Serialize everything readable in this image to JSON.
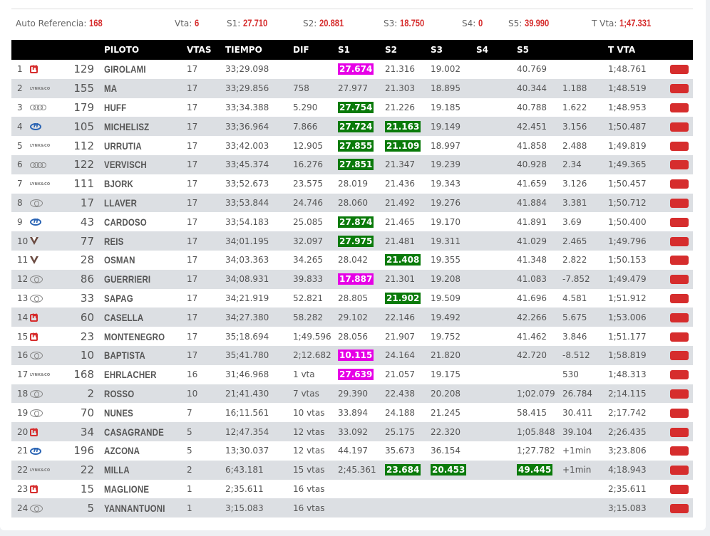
{
  "header": {
    "auto_ref_label": "Auto Referencia:",
    "auto_ref_value": "168",
    "vta_label": "Vta:",
    "vta_value": "6",
    "s1_label": "S1:",
    "s1_value": "27.710",
    "s2_label": "S2:",
    "s2_value": "20.881",
    "s3_label": "S3:",
    "s3_value": "18.750",
    "s4_label": "S4:",
    "s4_value": "0",
    "s5_label": "S5:",
    "s5_value": "39.990",
    "tvta_label": "T Vta:",
    "tvta_value": "1;47.331"
  },
  "columns": {
    "piloto": "PILOTO",
    "vtas": "VTAS",
    "tiempo": "TIEMPO",
    "dif": "DIF",
    "s1": "S1",
    "s2": "S2",
    "s3": "S3",
    "s4": "S4",
    "s5": "S5",
    "tvta": "T VTA"
  },
  "colors": {
    "accent_red": "#d62d2d",
    "best_pink": "#e600e6",
    "best_green": "#0a7a0a"
  },
  "rows": [
    {
      "pos": "1",
      "brand": "honda",
      "num": "129",
      "name": "GIROLAMI",
      "vtas": "17",
      "tiempo": "33;29.098",
      "dif": "",
      "s1": "27.674",
      "s1h": "pink",
      "s2": "21.316",
      "s2h": "",
      "s3": "19.002",
      "s3h": "",
      "s5": "40.769",
      "s5h": "",
      "gap": "",
      "tvta": "1;48.761"
    },
    {
      "pos": "2",
      "brand": "lynk",
      "num": "155",
      "name": "MA",
      "vtas": "17",
      "tiempo": "33;29.856",
      "dif": "758",
      "s1": "27.977",
      "s1h": "",
      "s2": "21.303",
      "s2h": "",
      "s3": "18.895",
      "s3h": "",
      "s5": "40.344",
      "s5h": "",
      "gap": "1.188",
      "tvta": "1;48.519"
    },
    {
      "pos": "3",
      "brand": "audi",
      "num": "179",
      "name": "HUFF",
      "vtas": "17",
      "tiempo": "33;34.388",
      "dif": "5.290",
      "s1": "27.754",
      "s1h": "green",
      "s2": "21.226",
      "s2h": "",
      "s3": "19.185",
      "s3h": "",
      "s5": "40.788",
      "s5h": "",
      "gap": "1.622",
      "tvta": "1;48.953"
    },
    {
      "pos": "4",
      "brand": "hyundai",
      "num": "105",
      "name": "MICHELISZ",
      "vtas": "17",
      "tiempo": "33;36.964",
      "dif": "7.866",
      "s1": "27.724",
      "s1h": "green",
      "s2": "21.163",
      "s2h": "green",
      "s3": "19.149",
      "s3h": "",
      "s5": "42.451",
      "s5h": "",
      "gap": "3.156",
      "tvta": "1;50.487"
    },
    {
      "pos": "5",
      "brand": "lynk",
      "num": "112",
      "name": "URRUTIA",
      "vtas": "17",
      "tiempo": "33;42.003",
      "dif": "12.905",
      "s1": "27.855",
      "s1h": "green",
      "s2": "21.109",
      "s2h": "green",
      "s3": "18.997",
      "s3h": "",
      "s5": "41.858",
      "s5h": "",
      "gap": "2.488",
      "tvta": "1;49.819"
    },
    {
      "pos": "6",
      "brand": "audi",
      "num": "122",
      "name": "VERVISCH",
      "vtas": "17",
      "tiempo": "33;45.374",
      "dif": "16.276",
      "s1": "27.851",
      "s1h": "green",
      "s2": "21.347",
      "s2h": "",
      "s3": "19.239",
      "s3h": "",
      "s5": "40.928",
      "s5h": "",
      "gap": "2.34",
      "tvta": "1;49.365"
    },
    {
      "pos": "7",
      "brand": "lynk",
      "num": "111",
      "name": "BJORK",
      "vtas": "17",
      "tiempo": "33;52.673",
      "dif": "23.575",
      "s1": "28.019",
      "s1h": "",
      "s2": "21.436",
      "s2h": "",
      "s3": "19.343",
      "s3h": "",
      "s5": "41.659",
      "s5h": "",
      "gap": "3.126",
      "tvta": "1;50.457"
    },
    {
      "pos": "8",
      "brand": "toyota",
      "num": "17",
      "name": "LLAVER",
      "vtas": "17",
      "tiempo": "33;53.844",
      "dif": "24.746",
      "s1": "28.060",
      "s1h": "",
      "s2": "21.492",
      "s2h": "",
      "s3": "19.276",
      "s3h": "",
      "s5": "41.884",
      "s5h": "",
      "gap": "3.381",
      "tvta": "1;50.712"
    },
    {
      "pos": "9",
      "brand": "hyundai",
      "num": "43",
      "name": "CARDOSO",
      "vtas": "17",
      "tiempo": "33;54.183",
      "dif": "25.085",
      "s1": "27.874",
      "s1h": "green",
      "s2": "21.465",
      "s2h": "",
      "s3": "19.170",
      "s3h": "",
      "s5": "41.891",
      "s5h": "",
      "gap": "3.69",
      "tvta": "1;50.400"
    },
    {
      "pos": "10",
      "brand": "cupra",
      "num": "77",
      "name": "REIS",
      "vtas": "17",
      "tiempo": "34;01.195",
      "dif": "32.097",
      "s1": "27.975",
      "s1h": "green",
      "s2": "21.481",
      "s2h": "",
      "s3": "19.311",
      "s3h": "",
      "s5": "41.029",
      "s5h": "",
      "gap": "2.465",
      "tvta": "1;49.796"
    },
    {
      "pos": "11",
      "brand": "cupra",
      "num": "28",
      "name": "OSMAN",
      "vtas": "17",
      "tiempo": "34;03.363",
      "dif": "34.265",
      "s1": "28.042",
      "s1h": "",
      "s2": "21.408",
      "s2h": "green",
      "s3": "19.355",
      "s3h": "",
      "s5": "41.348",
      "s5h": "",
      "gap": "2.822",
      "tvta": "1;50.153"
    },
    {
      "pos": "12",
      "brand": "toyota",
      "num": "86",
      "name": "GUERRIERI",
      "vtas": "17",
      "tiempo": "34;08.931",
      "dif": "39.833",
      "s1": "17.887",
      "s1h": "pink",
      "s2": "21.301",
      "s2h": "",
      "s3": "19.208",
      "s3h": "",
      "s5": "41.083",
      "s5h": "",
      "gap": "-7.852",
      "tvta": "1;49.479"
    },
    {
      "pos": "13",
      "brand": "toyota",
      "num": "33",
      "name": "SAPAG",
      "vtas": "17",
      "tiempo": "34;21.919",
      "dif": "52.821",
      "s1": "28.805",
      "s1h": "",
      "s2": "21.902",
      "s2h": "green",
      "s3": "19.509",
      "s3h": "",
      "s5": "41.696",
      "s5h": "",
      "gap": "4.581",
      "tvta": "1;51.912"
    },
    {
      "pos": "14",
      "brand": "honda",
      "num": "60",
      "name": "CASELLA",
      "vtas": "17",
      "tiempo": "34;27.380",
      "dif": "58.282",
      "s1": "29.102",
      "s1h": "",
      "s2": "22.146",
      "s2h": "",
      "s3": "19.492",
      "s3h": "",
      "s5": "42.266",
      "s5h": "",
      "gap": "5.675",
      "tvta": "1;53.006"
    },
    {
      "pos": "15",
      "brand": "honda",
      "num": "23",
      "name": "MONTENEGRO",
      "vtas": "17",
      "tiempo": "35;18.694",
      "dif": "1;49.596",
      "s1": "28.056",
      "s1h": "",
      "s2": "21.907",
      "s2h": "",
      "s3": "19.752",
      "s3h": "",
      "s5": "41.462",
      "s5h": "",
      "gap": "3.846",
      "tvta": "1;51.177"
    },
    {
      "pos": "16",
      "brand": "toyota",
      "num": "10",
      "name": "BAPTISTA",
      "vtas": "17",
      "tiempo": "35;41.780",
      "dif": "2;12.682",
      "s1": "10.115",
      "s1h": "pink",
      "s2": "24.164",
      "s2h": "",
      "s3": "21.820",
      "s3h": "",
      "s5": "42.720",
      "s5h": "",
      "gap": "-8.512",
      "tvta": "1;58.819"
    },
    {
      "pos": "17",
      "brand": "lynk",
      "num": "168",
      "name": "EHRLACHER",
      "vtas": "16",
      "tiempo": "31;46.968",
      "dif": "1 vta",
      "s1": "27.639",
      "s1h": "pink",
      "s2": "21.057",
      "s2h": "",
      "s3": "19.175",
      "s3h": "",
      "s5": "",
      "s5h": "",
      "gap": "530",
      "tvta": "1;48.313"
    },
    {
      "pos": "18",
      "brand": "toyota",
      "num": "2",
      "name": "ROSSO",
      "vtas": "10",
      "tiempo": "21;41.430",
      "dif": "7 vtas",
      "s1": "29.390",
      "s1h": "",
      "s2": "22.438",
      "s2h": "",
      "s3": "20.208",
      "s3h": "",
      "s5": "1;02.079",
      "s5h": "",
      "gap": "26.784",
      "tvta": "2;14.115"
    },
    {
      "pos": "19",
      "brand": "toyota",
      "num": "70",
      "name": "NUNES",
      "vtas": "7",
      "tiempo": "16;11.561",
      "dif": "10 vtas",
      "s1": "33.894",
      "s1h": "",
      "s2": "24.188",
      "s2h": "",
      "s3": "21.245",
      "s3h": "",
      "s5": "58.415",
      "s5h": "",
      "gap": "30.411",
      "tvta": "2;17.742"
    },
    {
      "pos": "20",
      "brand": "honda",
      "num": "34",
      "name": "CASAGRANDE",
      "vtas": "5",
      "tiempo": "12;47.354",
      "dif": "12 vtas",
      "s1": "33.092",
      "s1h": "",
      "s2": "25.175",
      "s2h": "",
      "s3": "22.320",
      "s3h": "",
      "s5": "1;05.848",
      "s5h": "",
      "gap": "39.104",
      "tvta": "2;26.435"
    },
    {
      "pos": "21",
      "brand": "hyundai",
      "num": "196",
      "name": "AZCONA",
      "vtas": "5",
      "tiempo": "13;30.037",
      "dif": "12 vtas",
      "s1": "44.197",
      "s1h": "",
      "s2": "35.673",
      "s2h": "",
      "s3": "36.154",
      "s3h": "",
      "s5": "1;27.782",
      "s5h": "",
      "gap": "+1min",
      "tvta": "3;23.806"
    },
    {
      "pos": "22",
      "brand": "lynk",
      "num": "22",
      "name": "MILLA",
      "vtas": "2",
      "tiempo": "6;43.181",
      "dif": "15 vtas",
      "s1": "2;45.361",
      "s1h": "",
      "s2": "23.684",
      "s2h": "green",
      "s3": "20.453",
      "s3h": "green",
      "s5": "49.445",
      "s5h": "green",
      "gap": "+1min",
      "tvta": "4;18.943"
    },
    {
      "pos": "23",
      "brand": "honda",
      "num": "15",
      "name": "MAGLIONE",
      "vtas": "1",
      "tiempo": "2;35.611",
      "dif": "16 vtas",
      "s1": "",
      "s1h": "",
      "s2": "",
      "s2h": "",
      "s3": "",
      "s3h": "",
      "s5": "",
      "s5h": "",
      "gap": "",
      "tvta": "2;35.611"
    },
    {
      "pos": "24",
      "brand": "toyota",
      "num": "5",
      "name": "YANNANTUONI",
      "vtas": "1",
      "tiempo": "3;15.083",
      "dif": "16 vtas",
      "s1": "",
      "s1h": "",
      "s2": "",
      "s2h": "",
      "s3": "",
      "s3h": "",
      "s5": "",
      "s5h": "",
      "gap": "",
      "tvta": "3;15.083"
    }
  ]
}
